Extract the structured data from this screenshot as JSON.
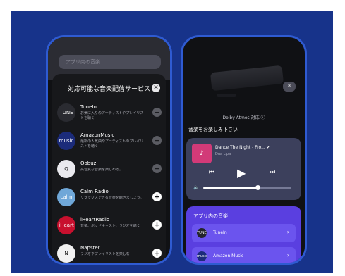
{
  "left_phone": {
    "backdrop_label": "アプリ内の音楽",
    "sheet": {
      "title": "対応可能な音楽配信サービス",
      "close_icon": "close-icon",
      "services": [
        {
          "name": "TuneIn",
          "description": "お気に入りのアーティストやプレイリストを聴く",
          "action": "remove",
          "icon_label": "TUNE"
        },
        {
          "name": "AmazonMusic",
          "description": "最新の人気曲やアーティストのプレイリストを聴く",
          "action": "remove",
          "icon_label": "music"
        },
        {
          "name": "Qobuz",
          "description": "高音質な音楽を楽しめる。",
          "action": "remove",
          "icon_label": "Q"
        },
        {
          "name": "Calm Radio",
          "description": "リラックスできる音楽を聴きましょう。",
          "action": "add",
          "icon_label": "calm"
        },
        {
          "name": "iHeartRadio",
          "description": "音楽、ポッドキャスト、ラジオを聴く",
          "action": "add",
          "icon_label": "iHeart"
        },
        {
          "name": "Napster",
          "description": "ラジオやプレイリストを楽しむ",
          "action": "add",
          "icon_label": "N"
        }
      ]
    }
  },
  "right_phone": {
    "badge": "8",
    "dolby_text": "Dolby Atmos 対応",
    "enjoy_title": "音楽をお楽しみ下さい",
    "player": {
      "track": "Dance The Night - Fro...",
      "artist": "Dua Lipa",
      "volume": 0.62
    },
    "apps": {
      "title": "アプリ内の音楽",
      "items": [
        {
          "label": "TuneIn",
          "icon_label": "TUNE"
        },
        {
          "label": "Amazon Music",
          "icon_label": "music"
        }
      ]
    }
  },
  "colors": {
    "stage": "#17338a",
    "phone_border": "#2f5bd2",
    "apps_panel": "#5a3fe0",
    "player_card": "#3c405c"
  }
}
